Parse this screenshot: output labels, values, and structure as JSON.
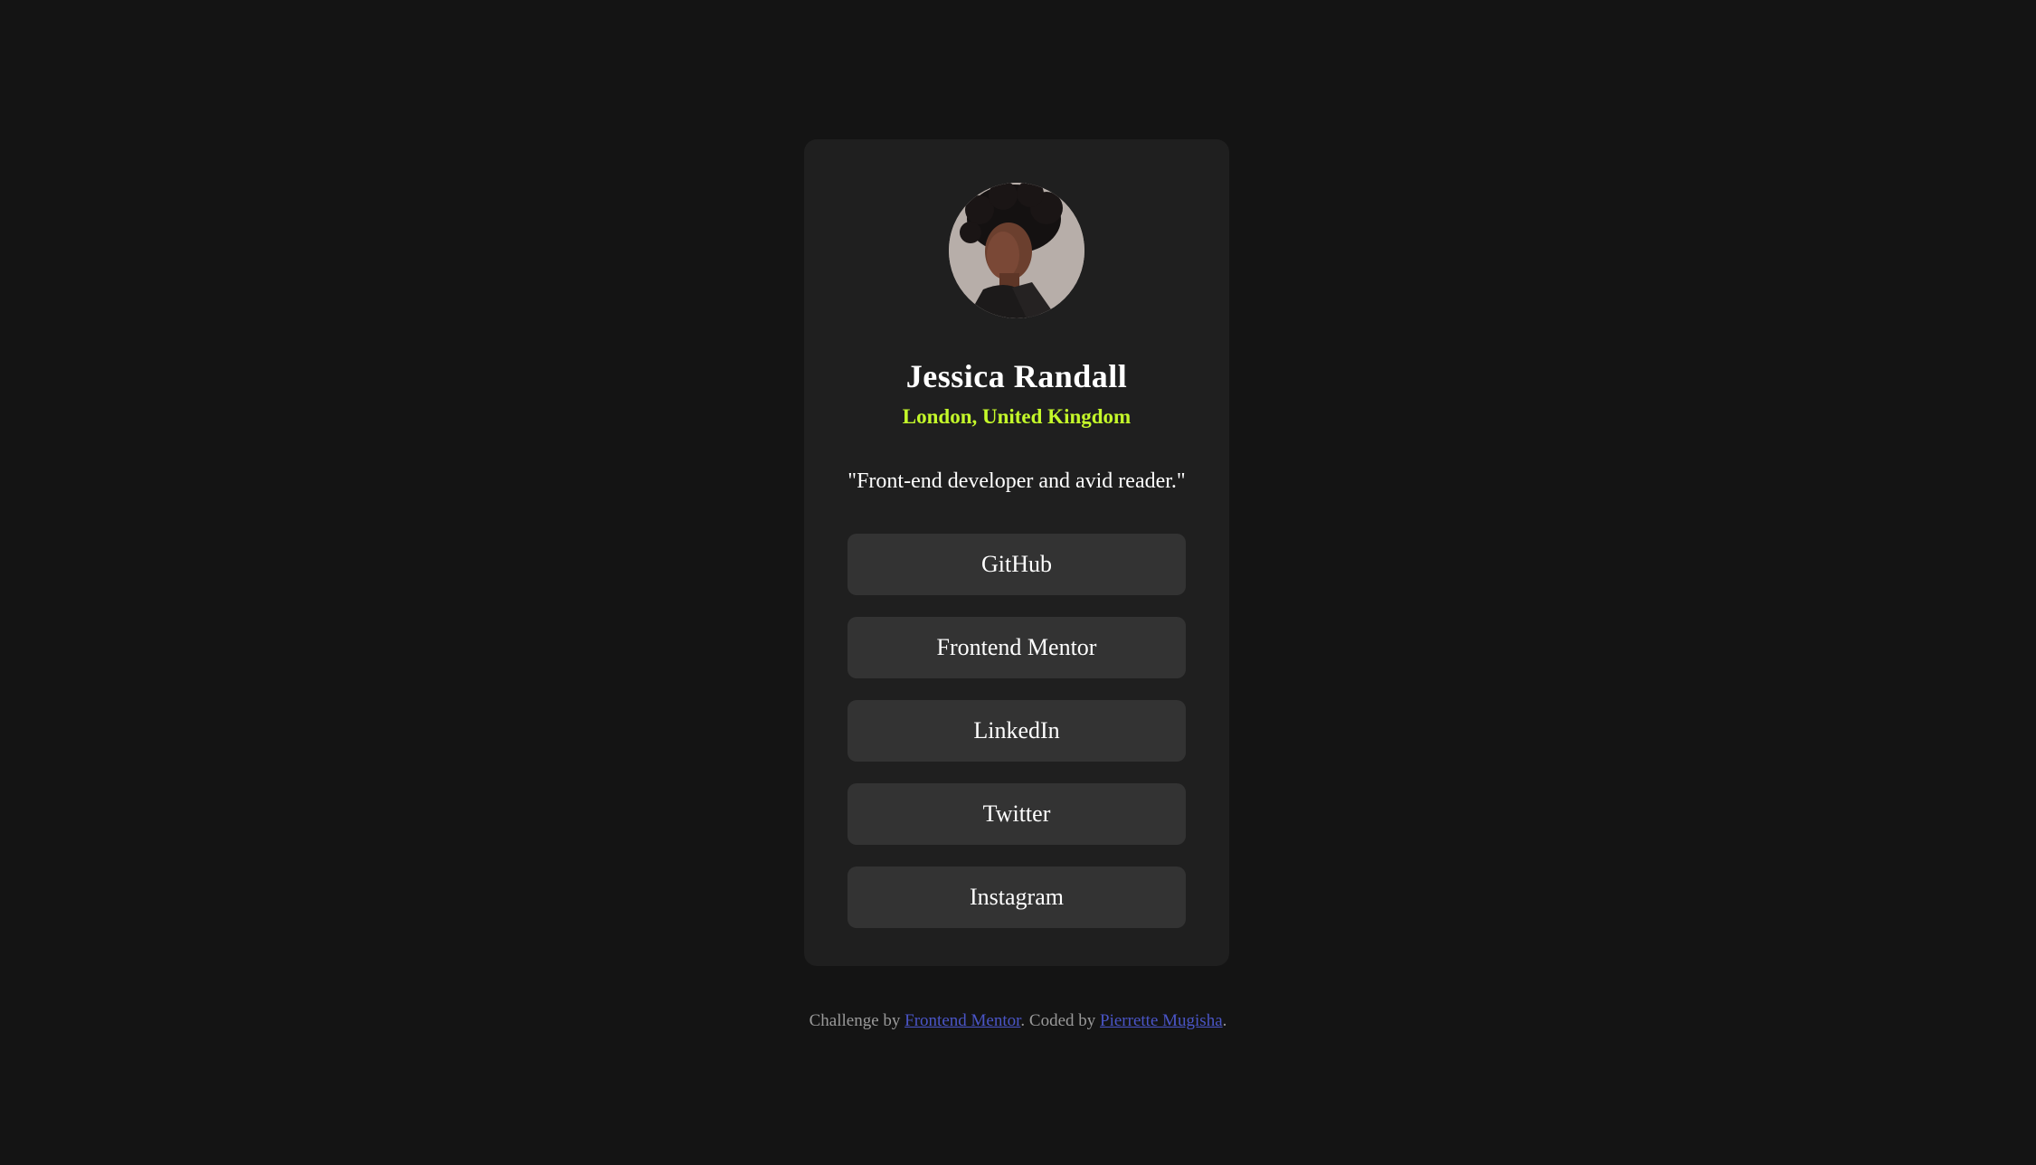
{
  "profile": {
    "name": "Jessica Randall",
    "location": "London, United Kingdom",
    "bio": "\"Front-end developer and avid reader.\"",
    "avatar_icon": "profile-photo"
  },
  "links": [
    {
      "label": "GitHub"
    },
    {
      "label": "Frontend Mentor"
    },
    {
      "label": "LinkedIn"
    },
    {
      "label": "Twitter"
    },
    {
      "label": "Instagram"
    }
  ],
  "footer": {
    "prefix": "Challenge by ",
    "challenge_link": "Frontend Mentor",
    "middle": ". Coded by ",
    "author_link": "Pierrette Mugisha",
    "suffix": "."
  },
  "colors": {
    "background": "#141414",
    "card": "#1f1f1f",
    "button": "#333333",
    "accent": "#c4f82a",
    "link": "#4a55c7"
  }
}
